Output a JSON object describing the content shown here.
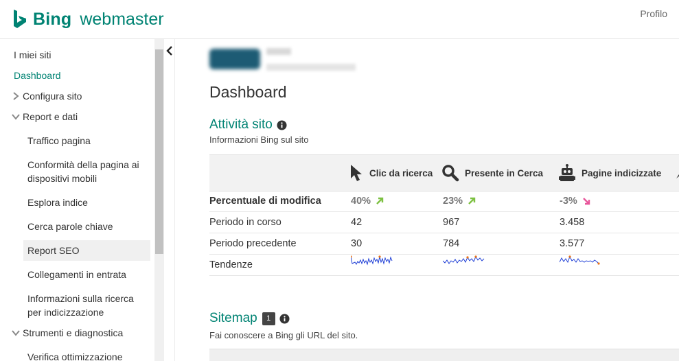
{
  "header": {
    "brand": "Bing",
    "product": "webmaster",
    "profile": "Profilo"
  },
  "sidebar": {
    "items": [
      {
        "label": "I miei siti"
      },
      {
        "label": "Dashboard"
      },
      {
        "label": "Configura sito"
      },
      {
        "label": "Report e dati"
      },
      {
        "label": "Traffico pagina"
      },
      {
        "label": "Conformità della pagina ai dispositivi mobili"
      },
      {
        "label": "Esplora indice"
      },
      {
        "label": "Cerca parole chiave"
      },
      {
        "label": "Report SEO"
      },
      {
        "label": "Collegamenti in entrata"
      },
      {
        "label": "Informazioni sulla ricerca per indicizzazione"
      },
      {
        "label": "Strumenti e diagnostica"
      },
      {
        "label": "Verifica ottimizzazione"
      }
    ]
  },
  "main": {
    "title": "Dashboard",
    "activity": {
      "title": "Attività sito",
      "subtitle": "Informazioni Bing sul sito",
      "columns": [
        "Clic da ricerca",
        "Presente in Cerca",
        "Pagine indicizzate"
      ],
      "rows": {
        "change": {
          "label": "Percentuale di modifica",
          "values": [
            "40%",
            "23%",
            "-3%"
          ]
        },
        "current": {
          "label": "Periodo in corso",
          "values": [
            "42",
            "967",
            "3.458"
          ]
        },
        "previous": {
          "label": "Periodo precedente",
          "values": [
            "30",
            "784",
            "3.577"
          ]
        },
        "trends": {
          "label": "Tendenze"
        }
      }
    },
    "sitemap": {
      "title": "Sitemap",
      "badge": "1",
      "subtitle": "Fai conoscere a Bing gli URL del sito."
    }
  },
  "colors": {
    "accent": "#008373",
    "up": "#7dc142",
    "down": "#e8559a",
    "sparkline": "#1f3fd6",
    "spark_high": "#e8731a"
  }
}
